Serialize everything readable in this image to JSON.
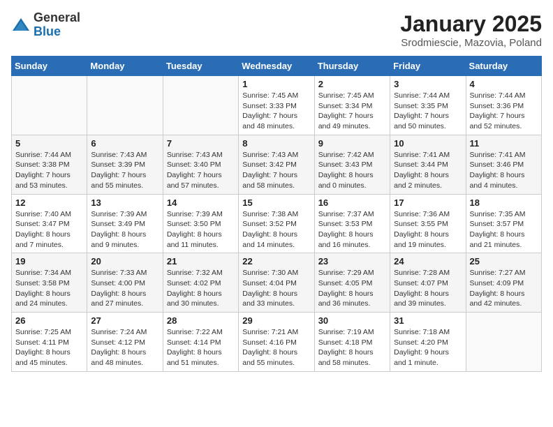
{
  "logo": {
    "general": "General",
    "blue": "Blue"
  },
  "header": {
    "title": "January 2025",
    "subtitle": "Srodmiescie, Mazovia, Poland"
  },
  "weekdays": [
    "Sunday",
    "Monday",
    "Tuesday",
    "Wednesday",
    "Thursday",
    "Friday",
    "Saturday"
  ],
  "weeks": [
    [
      {
        "day": "",
        "detail": ""
      },
      {
        "day": "",
        "detail": ""
      },
      {
        "day": "",
        "detail": ""
      },
      {
        "day": "1",
        "detail": "Sunrise: 7:45 AM\nSunset: 3:33 PM\nDaylight: 7 hours\nand 48 minutes."
      },
      {
        "day": "2",
        "detail": "Sunrise: 7:45 AM\nSunset: 3:34 PM\nDaylight: 7 hours\nand 49 minutes."
      },
      {
        "day": "3",
        "detail": "Sunrise: 7:44 AM\nSunset: 3:35 PM\nDaylight: 7 hours\nand 50 minutes."
      },
      {
        "day": "4",
        "detail": "Sunrise: 7:44 AM\nSunset: 3:36 PM\nDaylight: 7 hours\nand 52 minutes."
      }
    ],
    [
      {
        "day": "5",
        "detail": "Sunrise: 7:44 AM\nSunset: 3:38 PM\nDaylight: 7 hours\nand 53 minutes."
      },
      {
        "day": "6",
        "detail": "Sunrise: 7:43 AM\nSunset: 3:39 PM\nDaylight: 7 hours\nand 55 minutes."
      },
      {
        "day": "7",
        "detail": "Sunrise: 7:43 AM\nSunset: 3:40 PM\nDaylight: 7 hours\nand 57 minutes."
      },
      {
        "day": "8",
        "detail": "Sunrise: 7:43 AM\nSunset: 3:42 PM\nDaylight: 7 hours\nand 58 minutes."
      },
      {
        "day": "9",
        "detail": "Sunrise: 7:42 AM\nSunset: 3:43 PM\nDaylight: 8 hours\nand 0 minutes."
      },
      {
        "day": "10",
        "detail": "Sunrise: 7:41 AM\nSunset: 3:44 PM\nDaylight: 8 hours\nand 2 minutes."
      },
      {
        "day": "11",
        "detail": "Sunrise: 7:41 AM\nSunset: 3:46 PM\nDaylight: 8 hours\nand 4 minutes."
      }
    ],
    [
      {
        "day": "12",
        "detail": "Sunrise: 7:40 AM\nSunset: 3:47 PM\nDaylight: 8 hours\nand 7 minutes."
      },
      {
        "day": "13",
        "detail": "Sunrise: 7:39 AM\nSunset: 3:49 PM\nDaylight: 8 hours\nand 9 minutes."
      },
      {
        "day": "14",
        "detail": "Sunrise: 7:39 AM\nSunset: 3:50 PM\nDaylight: 8 hours\nand 11 minutes."
      },
      {
        "day": "15",
        "detail": "Sunrise: 7:38 AM\nSunset: 3:52 PM\nDaylight: 8 hours\nand 14 minutes."
      },
      {
        "day": "16",
        "detail": "Sunrise: 7:37 AM\nSunset: 3:53 PM\nDaylight: 8 hours\nand 16 minutes."
      },
      {
        "day": "17",
        "detail": "Sunrise: 7:36 AM\nSunset: 3:55 PM\nDaylight: 8 hours\nand 19 minutes."
      },
      {
        "day": "18",
        "detail": "Sunrise: 7:35 AM\nSunset: 3:57 PM\nDaylight: 8 hours\nand 21 minutes."
      }
    ],
    [
      {
        "day": "19",
        "detail": "Sunrise: 7:34 AM\nSunset: 3:58 PM\nDaylight: 8 hours\nand 24 minutes."
      },
      {
        "day": "20",
        "detail": "Sunrise: 7:33 AM\nSunset: 4:00 PM\nDaylight: 8 hours\nand 27 minutes."
      },
      {
        "day": "21",
        "detail": "Sunrise: 7:32 AM\nSunset: 4:02 PM\nDaylight: 8 hours\nand 30 minutes."
      },
      {
        "day": "22",
        "detail": "Sunrise: 7:30 AM\nSunset: 4:04 PM\nDaylight: 8 hours\nand 33 minutes."
      },
      {
        "day": "23",
        "detail": "Sunrise: 7:29 AM\nSunset: 4:05 PM\nDaylight: 8 hours\nand 36 minutes."
      },
      {
        "day": "24",
        "detail": "Sunrise: 7:28 AM\nSunset: 4:07 PM\nDaylight: 8 hours\nand 39 minutes."
      },
      {
        "day": "25",
        "detail": "Sunrise: 7:27 AM\nSunset: 4:09 PM\nDaylight: 8 hours\nand 42 minutes."
      }
    ],
    [
      {
        "day": "26",
        "detail": "Sunrise: 7:25 AM\nSunset: 4:11 PM\nDaylight: 8 hours\nand 45 minutes."
      },
      {
        "day": "27",
        "detail": "Sunrise: 7:24 AM\nSunset: 4:12 PM\nDaylight: 8 hours\nand 48 minutes."
      },
      {
        "day": "28",
        "detail": "Sunrise: 7:22 AM\nSunset: 4:14 PM\nDaylight: 8 hours\nand 51 minutes."
      },
      {
        "day": "29",
        "detail": "Sunrise: 7:21 AM\nSunset: 4:16 PM\nDaylight: 8 hours\nand 55 minutes."
      },
      {
        "day": "30",
        "detail": "Sunrise: 7:19 AM\nSunset: 4:18 PM\nDaylight: 8 hours\nand 58 minutes."
      },
      {
        "day": "31",
        "detail": "Sunrise: 7:18 AM\nSunset: 4:20 PM\nDaylight: 9 hours\nand 1 minute."
      },
      {
        "day": "",
        "detail": ""
      }
    ]
  ]
}
